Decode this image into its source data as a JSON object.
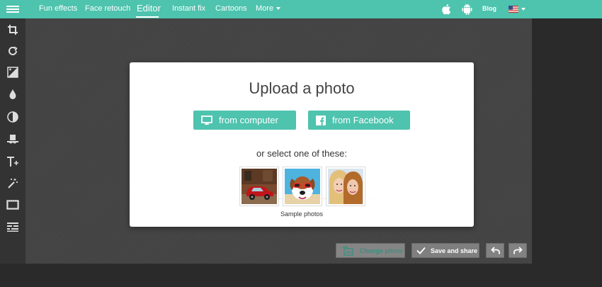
{
  "nav": {
    "items": [
      "Fun effects",
      "Face retouch",
      "Editor",
      "Instant fix",
      "Cartoons",
      "More"
    ],
    "blog": "Blog"
  },
  "toolbar": {
    "tools": [
      "crop-icon",
      "rotate-icon",
      "exposure-icon",
      "drop-icon",
      "contrast-icon",
      "hat-icon",
      "text-icon",
      "magic-wand-icon",
      "frame-icon",
      "texture-icon"
    ]
  },
  "dialog": {
    "title": "Upload a photo",
    "from_computer": "from computer",
    "from_facebook": "from Facebook",
    "select_text": "or select one of these:",
    "sample_caption": "Sample photos"
  },
  "bottom": {
    "change_photo": "Change photo",
    "save_share": "Save and share"
  },
  "colors": {
    "accent": "#4ec3ae",
    "toolbar_bg": "#333333",
    "canvas_bg": "#444444"
  }
}
